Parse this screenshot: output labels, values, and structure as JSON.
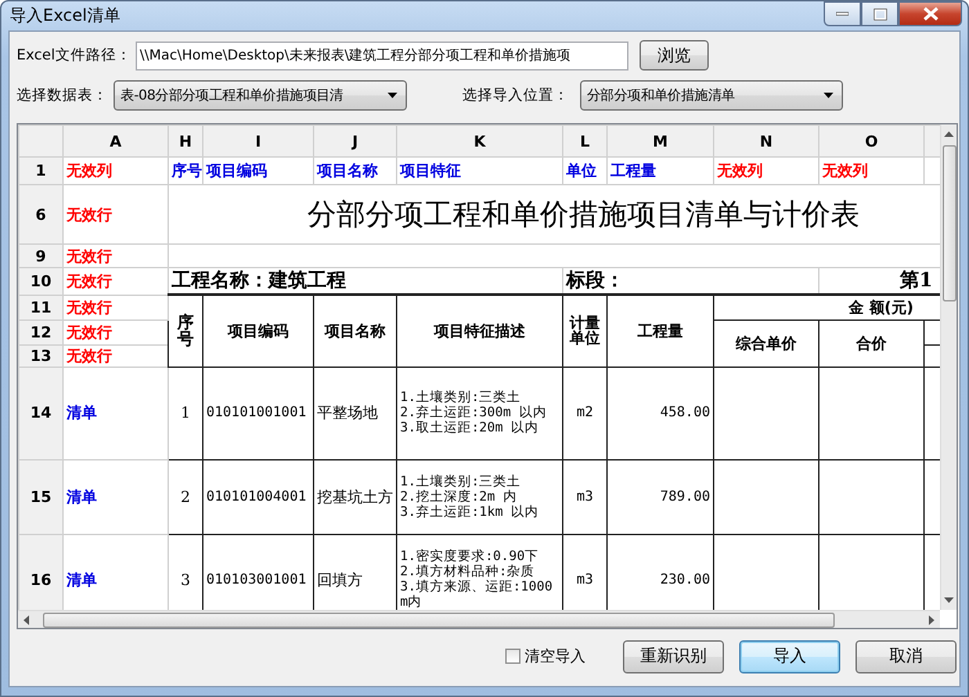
{
  "window": {
    "title": "导入Excel清单"
  },
  "file": {
    "label": "Excel文件路径：",
    "value": "\\\\Mac\\Home\\Desktop\\未来报表\\建筑工程分部分项工程和单价措施项",
    "browse": "浏览"
  },
  "sheet": {
    "label": "选择数据表：",
    "value": "表-08分部分项工程和单价措施项目清"
  },
  "target": {
    "label": "选择导入位置：",
    "value": "分部分项和单价措施清单"
  },
  "grid": {
    "columns": [
      "A",
      "H",
      "I",
      "J",
      "K",
      "L",
      "M",
      "N",
      "O"
    ],
    "mapping_row": {
      "number": "1",
      "cells": [
        {
          "text": "无效列",
          "kind": "invalid"
        },
        {
          "text": "序号",
          "kind": "field"
        },
        {
          "text": "项目编码",
          "kind": "field"
        },
        {
          "text": "项目名称",
          "kind": "field"
        },
        {
          "text": "项目特征",
          "kind": "field"
        },
        {
          "text": "单位",
          "kind": "field"
        },
        {
          "text": "工程量",
          "kind": "field"
        },
        {
          "text": "无效列",
          "kind": "invalid"
        },
        {
          "text": "无效列",
          "kind": "invalid"
        }
      ]
    },
    "header_rows": [
      {
        "number": "6",
        "status": "无效行",
        "kind": "invalid"
      },
      {
        "number": "9",
        "status": "无效行",
        "kind": "invalid"
      },
      {
        "number": "10",
        "status": "无效行",
        "kind": "invalid"
      },
      {
        "number": "11",
        "status": "无效行",
        "kind": "invalid"
      },
      {
        "number": "12",
        "status": "无效行",
        "kind": "invalid"
      },
      {
        "number": "13",
        "status": "无效行",
        "kind": "invalid"
      }
    ],
    "sheet_title": "分部分项工程和单价措施项目清单与计价表",
    "project_name": "工程名称：建筑工程",
    "section": "标段：",
    "page": "第1",
    "headers": {
      "seq": "序号",
      "code": "项目编码",
      "name": "项目名称",
      "feature": "项目特征描述",
      "unit": "计量单位",
      "quantity": "工程量",
      "amount": "金 额(元)",
      "unit_price": "综合单价",
      "total": "合价"
    },
    "items": [
      {
        "number": "14",
        "status": "清单",
        "kind": "list",
        "seq": "1",
        "code": "010101001001",
        "name": "平整场地",
        "features": [
          "1.土壤类别:三类土",
          "2.弃土运距:300m 以内",
          "3.取土运距:20m 以内"
        ],
        "unit": "m2",
        "quantity": "458.00"
      },
      {
        "number": "15",
        "status": "清单",
        "kind": "list",
        "seq": "2",
        "code": "010101004001",
        "name": "挖基坑土方",
        "features": [
          "1.土壤类别:三类土",
          "2.挖土深度:2m 内",
          "3.弃土运距:1km 以内"
        ],
        "unit": "m3",
        "quantity": "789.00"
      },
      {
        "number": "16",
        "status": "清单",
        "kind": "list",
        "seq": "3",
        "code": "010103001001",
        "name": "回填方",
        "features": [
          "1.密实度要求:0.90下",
          "2.填方材料品种:杂质",
          "3.填方来源、运距:1000m内"
        ],
        "unit": "m3",
        "quantity": "230.00"
      }
    ]
  },
  "footer": {
    "clear": {
      "label": "清空导入",
      "checked": false
    },
    "buttons": [
      {
        "label": "重新识别",
        "default": false
      },
      {
        "label": "导入",
        "default": true
      },
      {
        "label": "取消",
        "default": false
      }
    ]
  }
}
